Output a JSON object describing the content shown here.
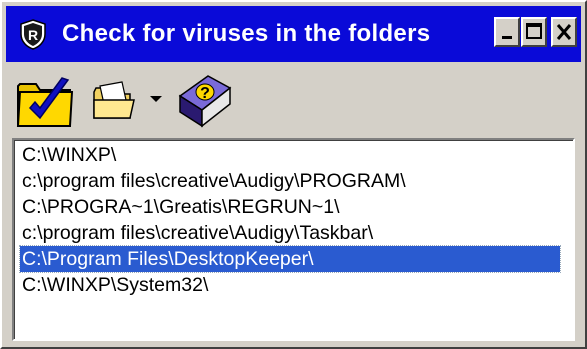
{
  "window": {
    "title": "Check for viruses in the folders",
    "buttons": {
      "minimize": "minimize",
      "maximize": "maximize",
      "close": "close"
    }
  },
  "toolbar": {
    "icons": [
      "check-folder-icon",
      "open-folder-icon",
      "dropdown-arrow-icon",
      "help-book-icon"
    ]
  },
  "folders": {
    "items": [
      "C:\\WINXP\\",
      "c:\\program files\\creative\\Audigy\\PROGRAM\\",
      "C:\\PROGRA~1\\Greatis\\REGRUN~1\\",
      "c:\\program files\\creative\\Audigy\\Taskbar\\",
      "C:\\Program Files\\DesktopKeeper\\",
      "C:\\WINXP\\System32\\"
    ],
    "selected_index": 4
  },
  "colors": {
    "titlebar": "#0a0ad8",
    "selection": "#2a5bd0",
    "face": "#d4d0c8"
  }
}
